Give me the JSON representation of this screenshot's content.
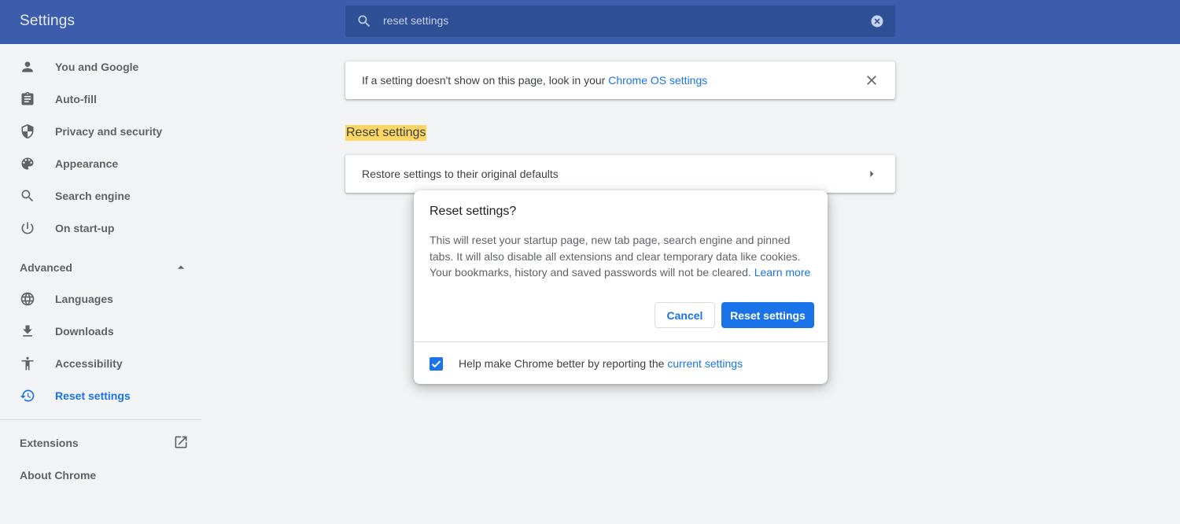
{
  "header": {
    "title": "Settings",
    "search_value": "reset settings",
    "search_icon": "search-icon",
    "clear_icon": "clear-search-icon"
  },
  "sidebar": {
    "items": [
      {
        "label": "You and Google",
        "icon": "person-icon"
      },
      {
        "label": "Auto-fill",
        "icon": "clipboard-icon"
      },
      {
        "label": "Privacy and security",
        "icon": "shield-icon"
      },
      {
        "label": "Appearance",
        "icon": "palette-icon"
      },
      {
        "label": "Search engine",
        "icon": "search-icon"
      },
      {
        "label": "On start-up",
        "icon": "power-icon"
      }
    ],
    "advanced_label": "Advanced",
    "advanced_items": [
      {
        "label": "Languages",
        "icon": "globe-icon"
      },
      {
        "label": "Downloads",
        "icon": "download-icon"
      },
      {
        "label": "Accessibility",
        "icon": "accessibility-icon"
      },
      {
        "label": "Reset settings",
        "icon": "restore-icon",
        "active": true
      }
    ],
    "extensions_label": "Extensions",
    "about_label": "About Chrome"
  },
  "main": {
    "info_text": "If a setting doesn't show on this page, look in your",
    "info_link": "Chrome OS settings",
    "section_title": "Reset settings",
    "restore_label": "Restore settings to their original defaults"
  },
  "dialog": {
    "title": "Reset settings?",
    "body": "This will reset your startup page, new tab page, search engine and pinned tabs. It will also disable all extensions and clear temporary data like cookies. Your bookmarks, history and saved passwords will not be cleared.",
    "learn_more": "Learn more",
    "cancel_label": "Cancel",
    "reset_label": "Reset settings",
    "footer_text": "Help make Chrome better by reporting the",
    "footer_link": "current settings",
    "checkbox_checked": true
  },
  "colors": {
    "header_bg": "#3b5dab",
    "accent": "#1a73e8",
    "highlight": "#fdd663",
    "page_bg": "#f1f3f4"
  }
}
